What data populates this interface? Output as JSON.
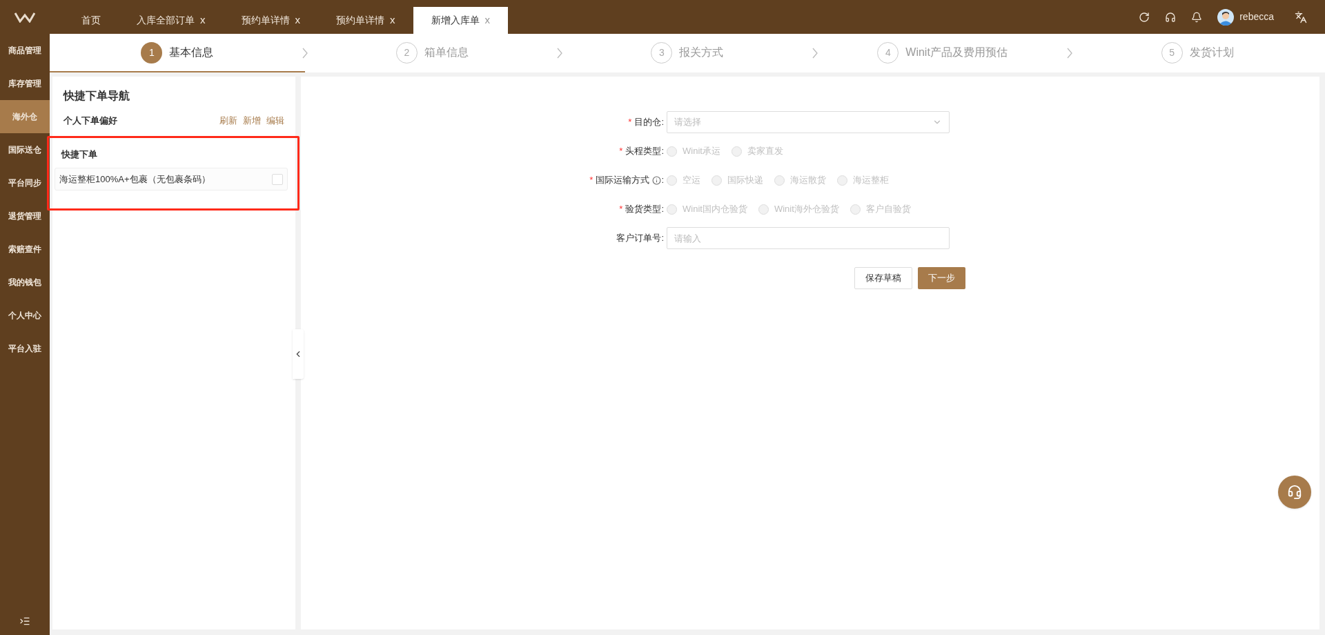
{
  "top_bar": {
    "tabs": [
      {
        "label": "首页",
        "selected": false
      },
      {
        "label": "入库全部订单",
        "selected": false,
        "close": "x"
      },
      {
        "label": "预约单详情",
        "selected": false,
        "close": "x"
      },
      {
        "label": "预约单详情",
        "selected": false,
        "close": "x"
      },
      {
        "label": "新增入库单",
        "selected": true,
        "close": "x"
      }
    ],
    "user": "rebecca"
  },
  "sidebar": {
    "items": [
      {
        "label": "商品管理",
        "selected": false
      },
      {
        "label": "库存管理",
        "selected": false
      },
      {
        "label": "海外仓",
        "selected": true
      },
      {
        "label": "国际送仓",
        "selected": false
      },
      {
        "label": "平台同步",
        "selected": false
      },
      {
        "label": "退货管理",
        "selected": false
      },
      {
        "label": "索赔查件",
        "selected": false
      },
      {
        "label": "我的钱包",
        "selected": false
      },
      {
        "label": "个人中心",
        "selected": false
      },
      {
        "label": "平台入驻",
        "selected": false
      }
    ]
  },
  "steps": [
    {
      "number": "1",
      "label": "基本信息",
      "selected": true
    },
    {
      "number": "2",
      "label": "箱单信息",
      "selected": false
    },
    {
      "number": "3",
      "label": "报关方式",
      "selected": false
    },
    {
      "number": "4",
      "label": "Winit产品及费用预估",
      "selected": false
    },
    {
      "number": "5",
      "label": "发货计划",
      "selected": false
    }
  ],
  "quick_nav": {
    "title": "快捷下单导航",
    "preferences_label": "个人下单偏好",
    "actions": [
      "刷新",
      "新增",
      "编辑"
    ],
    "quick_order": {
      "title": "快捷下单",
      "highlighted": true,
      "items": [
        {
          "label": "海运整柜100%A+包裹（无包裹条码）",
          "checked": false
        }
      ]
    }
  },
  "form": {
    "fields": [
      {
        "kind": "select",
        "label": "目的仓",
        "required": true,
        "placeholder": "请选择"
      },
      {
        "kind": "radio",
        "label": "头程类型",
        "required": true,
        "disabled": true,
        "options": [
          {
            "label": "Winit承运",
            "selected": false
          },
          {
            "label": "卖家直发",
            "selected": false
          }
        ]
      },
      {
        "kind": "radio",
        "label": "国际运输方式",
        "required": true,
        "info": true,
        "disabled": true,
        "options": [
          {
            "label": "空运",
            "selected": false
          },
          {
            "label": "国际快递",
            "selected": false
          },
          {
            "label": "海运散货",
            "selected": false
          },
          {
            "label": "海运整柜",
            "selected": false
          }
        ]
      },
      {
        "kind": "radio",
        "label": "验货类型",
        "required": true,
        "disabled": true,
        "options": [
          {
            "label": "Winit国内仓验货",
            "selected": false
          },
          {
            "label": "Winit海外仓验货",
            "selected": false
          },
          {
            "label": "客户自验货",
            "selected": false
          }
        ]
      },
      {
        "kind": "input",
        "label": "客户订单号",
        "required": false,
        "placeholder": "请输入"
      }
    ],
    "required_mark": "*",
    "colon": ":",
    "buttons": [
      {
        "label": "保存草稿",
        "kind": "secondary"
      },
      {
        "label": "下一步",
        "kind": "primary"
      }
    ]
  }
}
